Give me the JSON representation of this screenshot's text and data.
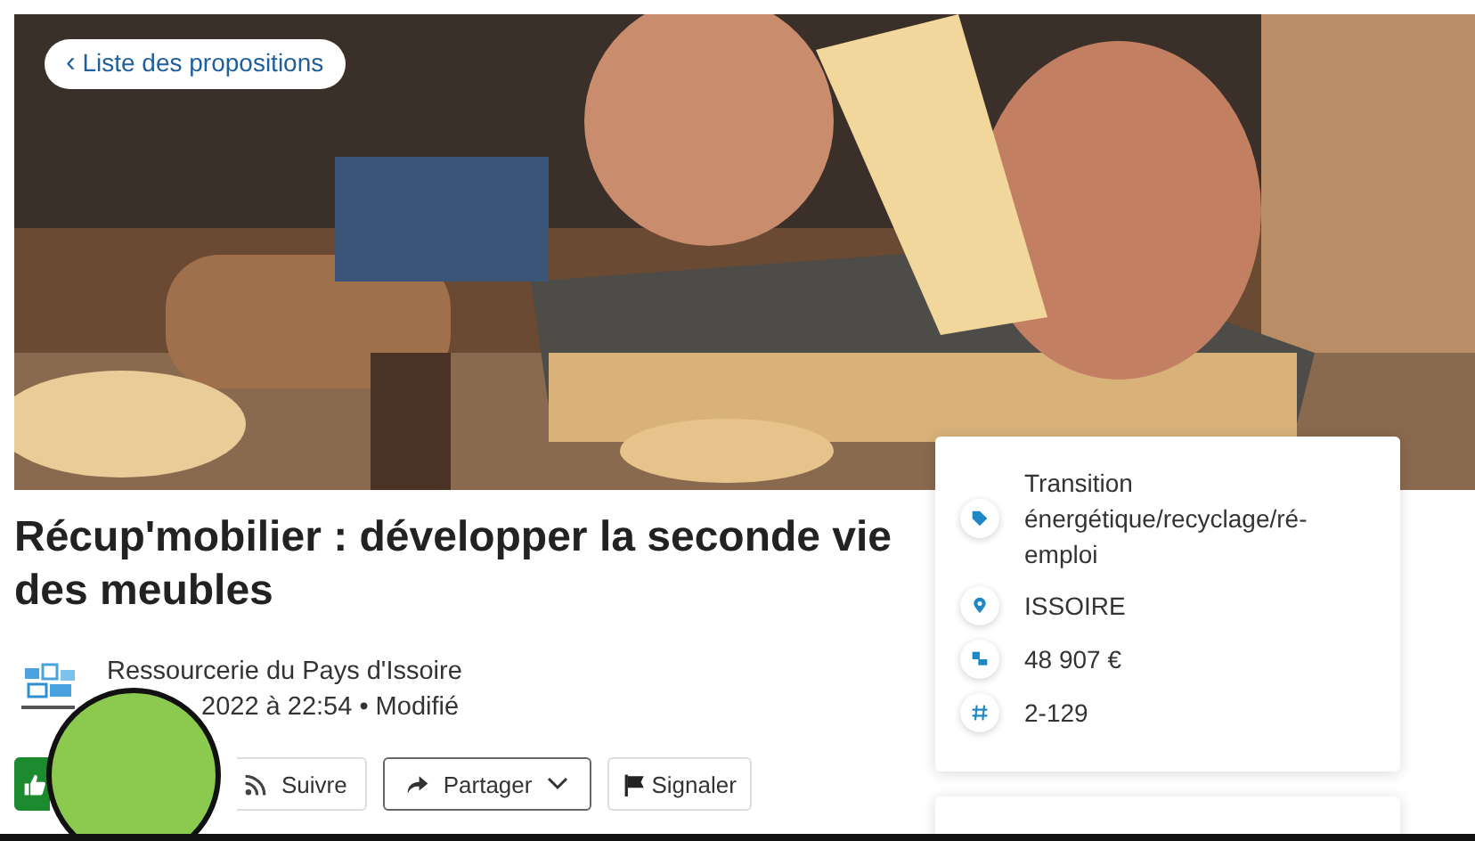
{
  "back_link": {
    "label": "Liste des propositions",
    "icon": "‹"
  },
  "title": "Récup'mobilier : développer la seconde vie des meubles",
  "author": {
    "name": "Ressourcerie du Pays d'Issoire",
    "date": "2022 à 22:54 • Modifié"
  },
  "actions": [
    {
      "kind": "like"
    },
    {
      "kind": "follow",
      "label": "Suivre"
    },
    {
      "kind": "share",
      "label": "Partager"
    },
    {
      "kind": "report",
      "label": "Signaler"
    }
  ],
  "details": [
    {
      "kind": "tag",
      "text": "Transition énergétique/recyclage/ré-emploi"
    },
    {
      "kind": "place",
      "text": "ISSOIRE"
    },
    {
      "kind": "budget",
      "text": "48 907 €"
    },
    {
      "kind": "number",
      "text": "2-129"
    }
  ]
}
